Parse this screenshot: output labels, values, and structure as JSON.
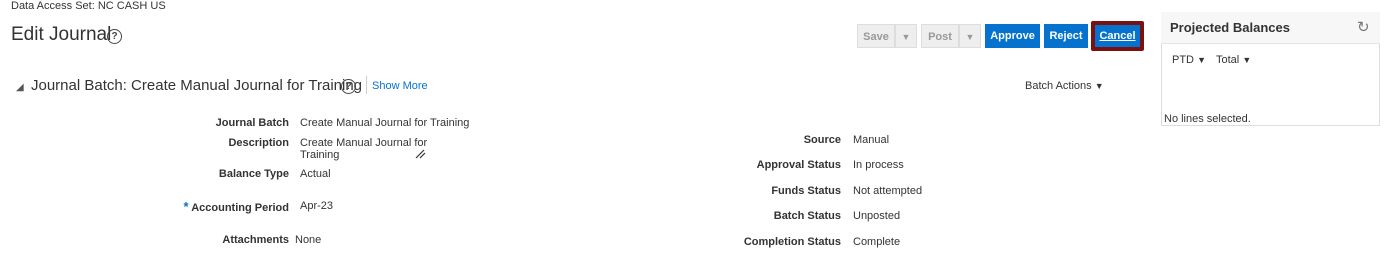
{
  "header": {
    "data_access_set": "Data Access Set:  NC CASH US",
    "page_title": "Edit Journal",
    "help_glyph": "?"
  },
  "toolbar": {
    "save_label": "Save",
    "post_label": "Post",
    "approve_label": "Approve",
    "reject_label": "Reject",
    "cancel_label": "Cancel",
    "menu_caret": "▼"
  },
  "section": {
    "collapse_glyph": "◢",
    "title": "Journal Batch: Create Manual Journal for Training",
    "help_glyph": "?",
    "show_more": "Show More",
    "batch_actions": "Batch Actions",
    "caret": "▼"
  },
  "form_left": {
    "journal_batch_label": "Journal Batch",
    "journal_batch_value": "Create Manual Journal for Training",
    "description_label": "Description",
    "description_value_line1": "Create Manual Journal for",
    "description_value_line2": "Training",
    "balance_type_label": "Balance Type",
    "balance_type_value": "Actual",
    "required_mark": "*",
    "accounting_period_label": "Accounting Period",
    "accounting_period_value": "Apr-23",
    "attachments_label": "Attachments",
    "attachments_value": "None"
  },
  "form_right": {
    "source_label": "Source",
    "source_value": "Manual",
    "approval_status_label": "Approval Status",
    "approval_status_value": "In process",
    "funds_status_label": "Funds Status",
    "funds_status_value": "Not attempted",
    "batch_status_label": "Batch Status",
    "batch_status_value": "Unposted",
    "completion_status_label": "Completion Status",
    "completion_status_value": "Complete"
  },
  "panel": {
    "title": "Projected Balances",
    "refresh_glyph": "↻",
    "ptd_label": "PTD",
    "total_label": "Total",
    "caret": "▼",
    "empty_message": "No lines selected."
  },
  "icons": {
    "help": "help-icon",
    "refresh": "refresh-icon",
    "resize": "resize-handle-icon",
    "collapse": "collapse-triangle-icon"
  },
  "colors": {
    "primary": "#0572ce",
    "cancel_focus": "#7a1010",
    "disabled_bg": "#eeeeee"
  }
}
